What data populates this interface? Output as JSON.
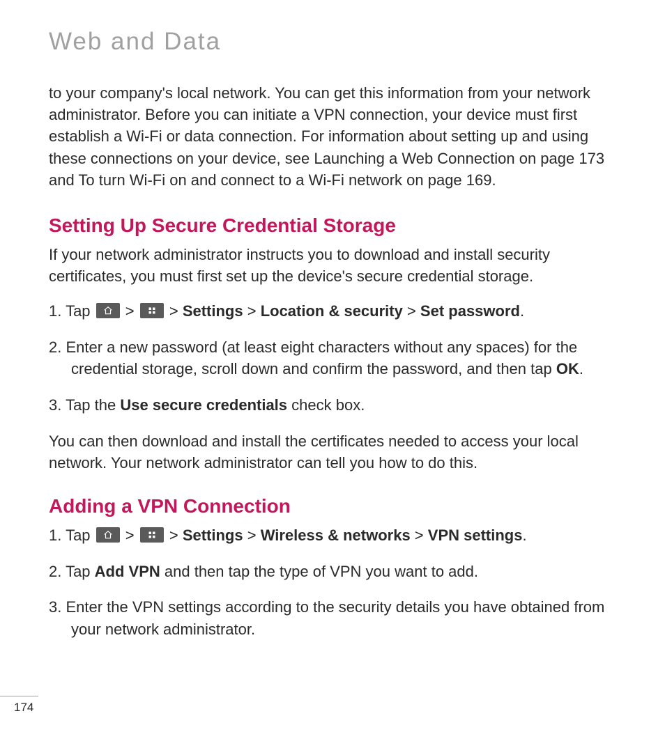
{
  "page": {
    "title": "Web and Data",
    "intro": "to your company's local network. You can get this information from your network administrator. Before you can initiate a VPN connection, your device must first establish a Wi-Fi or data connection. For information about setting up and using these connections on your device, see Launching a Web Connection on page 173 and To turn Wi-Fi on and connect to a Wi-Fi network on page 169.",
    "number": "174"
  },
  "sec1": {
    "heading": "Setting Up Secure Credential Storage",
    "intro": "If your network administrator instructs you to download and install security certificates, you must first set up the device's secure credential storage.",
    "step1_pre": "1.  Tap  ",
    "step1_sep1": "  >  ",
    "step1_sep2": "  > ",
    "step1_b1": "Settings",
    "step1_sep3": " > ",
    "step1_b2": "Location & security",
    "step1_sep4": " > ",
    "step1_b3": "Set password",
    "step1_post": ".",
    "step2_pre": "2. Enter a new password (at least eight characters without any spaces) for the credential storage, scroll down and confirm the password, and then tap ",
    "step2_b1": "OK",
    "step2_post": ".",
    "step3_pre": "3. Tap the ",
    "step3_b1": "Use secure credentials",
    "step3_post": " check box.",
    "outro": "You can then download and install the certificates needed to access your local network. Your network administrator can tell you how to do this."
  },
  "sec2": {
    "heading": "Adding a VPN Connection",
    "step1_pre": "1. Tap  ",
    "step1_sep1": "  >  ",
    "step1_sep2": "  > ",
    "step1_b1": "Settings",
    "step1_sep3": " > ",
    "step1_b2": "Wireless & networks",
    "step1_sep4": " > ",
    "step1_b3": "VPN settings",
    "step1_post": ".",
    "step2_pre": "2. Tap ",
    "step2_b1": "Add VPN",
    "step2_post": " and then tap the type of VPN you want to add.",
    "step3": "3. Enter the VPN settings according to the security details you have obtained from your network administrator."
  }
}
